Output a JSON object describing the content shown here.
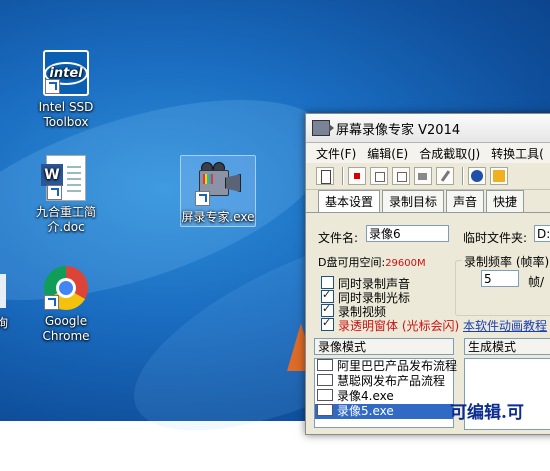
{
  "desktop": {
    "icons": [
      {
        "label1": "Intel SSD",
        "label2": "Toolbox",
        "icon": "intel-icon"
      },
      {
        "label1": "九合重工简",
        "label2": "介.doc",
        "icon": "word-doc-icon"
      },
      {
        "label1": "Google",
        "label2": "Chrome",
        "icon": "chrome-icon"
      },
      {
        "label1": "屏录专家.exe",
        "label2": "",
        "icon": "camera-icon"
      }
    ],
    "edge_label": "询"
  },
  "window": {
    "title": "屏幕录像专家 V2014",
    "menu": [
      "文件(F)",
      "编辑(E)",
      "合成截取(J)",
      "转换工具("
    ],
    "tabs": [
      "基本设置",
      "录制目标",
      "声音",
      "快捷"
    ],
    "filename_label": "文件名:",
    "filename_value": "录像6",
    "tempfolder_label": "临时文件夹:",
    "tempfolder_value": "D:",
    "disk_label": "D盘可用空间:",
    "disk_value": "29600M",
    "framerate_label": "录制频率 (帧率)",
    "framerate_value": "5",
    "framerate_unit": "帧/",
    "options": [
      {
        "label": "同时录制声音",
        "checked": false
      },
      {
        "label": "同时录制光标",
        "checked": true
      },
      {
        "label": "录制视频",
        "checked": true
      },
      {
        "label": "录透明窗体 (光标会闪)",
        "checked": true
      }
    ],
    "help_link": "本软件动画教程",
    "panel_left_header": "录像模式",
    "panel_right_header": "生成模式",
    "files": [
      "阿里巴巴产品发布流程",
      "慧聪网发布产品流程",
      "录像4.exe",
      "录像5.exe"
    ],
    "selected_file_index": 3,
    "preview_text": "可编辑.可"
  }
}
